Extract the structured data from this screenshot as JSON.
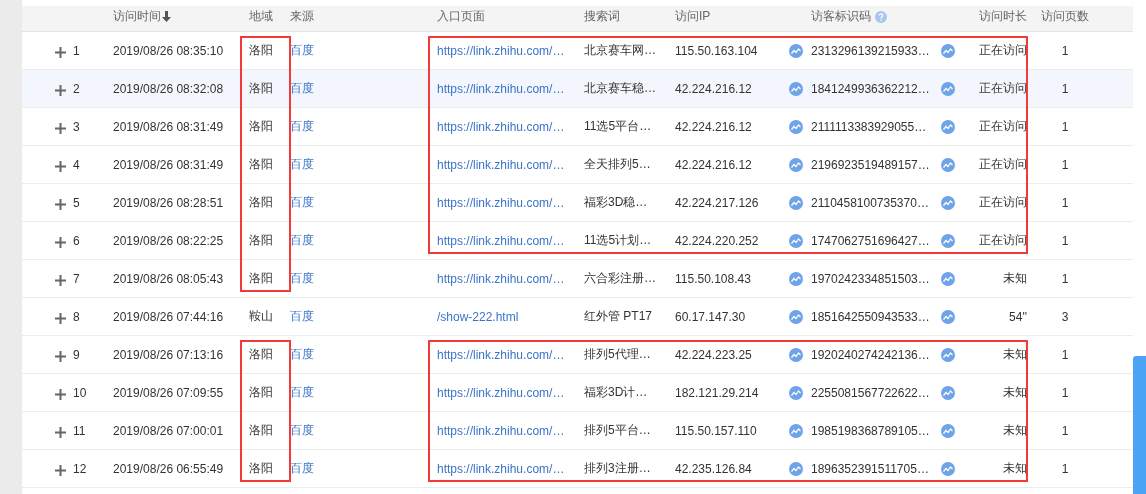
{
  "table": {
    "columns": [
      {
        "label": "访问时间",
        "sorted": true,
        "help": false
      },
      {
        "label": "地域",
        "sorted": false,
        "help": false
      },
      {
        "label": "来源",
        "sorted": false,
        "help": false
      },
      {
        "label": "入口页面",
        "sorted": false,
        "help": false
      },
      {
        "label": "搜索词",
        "sorted": false,
        "help": false
      },
      {
        "label": "访问IP",
        "sorted": false,
        "help": false
      },
      {
        "label": "访客标识码",
        "sorted": false,
        "help": true
      },
      {
        "label": "访问时长",
        "sorted": false,
        "help": false
      },
      {
        "label": "访问页数",
        "sorted": false,
        "help": false
      }
    ],
    "rows": [
      {
        "index": "1",
        "cells": [
          "2019/08/26 08:35:10",
          "洛阳",
          "百度",
          "https://link.zhihu.com/…",
          "北京赛车网…",
          "115.50.163.104",
          "2313296139215933…",
          "正在访问",
          "1"
        ],
        "selected": false,
        "region_framed": true,
        "details_framed": true
      },
      {
        "index": "2",
        "cells": [
          "2019/08/26 08:32:08",
          "洛阳",
          "百度",
          "https://link.zhihu.com/…",
          "北京赛车稳…",
          "42.224.216.12",
          "1841249936362212…",
          "正在访问",
          "1"
        ],
        "selected": true,
        "region_framed": true,
        "details_framed": true
      },
      {
        "index": "3",
        "cells": [
          "2019/08/26 08:31:49",
          "洛阳",
          "百度",
          "https://link.zhihu.com/…",
          "11选5平台…",
          "42.224.216.12",
          "2111113383929055…",
          "正在访问",
          "1"
        ],
        "selected": false,
        "region_framed": true,
        "details_framed": true
      },
      {
        "index": "4",
        "cells": [
          "2019/08/26 08:31:49",
          "洛阳",
          "百度",
          "https://link.zhihu.com/…",
          "全天排列5…",
          "42.224.216.12",
          "2196923519489157…",
          "正在访问",
          "1"
        ],
        "selected": false,
        "region_framed": true,
        "details_framed": true
      },
      {
        "index": "5",
        "cells": [
          "2019/08/26 08:28:51",
          "洛阳",
          "百度",
          "https://link.zhihu.com/…",
          "福彩3D稳…",
          "42.224.217.126",
          "2110458100735370…",
          "正在访问",
          "1"
        ],
        "selected": false,
        "region_framed": true,
        "details_framed": true
      },
      {
        "index": "6",
        "cells": [
          "2019/08/26 08:22:25",
          "洛阳",
          "百度",
          "https://link.zhihu.com/…",
          "11选5计划…",
          "42.224.220.252",
          "1747062751696427…",
          "正在访问",
          "1"
        ],
        "selected": false,
        "region_framed": true,
        "details_framed": true
      },
      {
        "index": "7",
        "cells": [
          "2019/08/26 08:05:43",
          "洛阳",
          "百度",
          "https://link.zhihu.com/…",
          "六合彩注册…",
          "115.50.108.43",
          "1970242334851503…",
          "未知",
          "1"
        ],
        "selected": false,
        "region_framed": true,
        "details_framed": false
      },
      {
        "index": "8",
        "cells": [
          "2019/08/26 07:44:16",
          "鞍山",
          "百度",
          "/show-222.html",
          "红外管 PT17",
          "60.17.147.30",
          "1851642550943533…",
          "54''",
          "3"
        ],
        "selected": false,
        "region_framed": false,
        "details_framed": false
      },
      {
        "index": "9",
        "cells": [
          "2019/08/26 07:13:16",
          "洛阳",
          "百度",
          "https://link.zhihu.com/…",
          "排列5代理…",
          "42.224.223.25",
          "1920240274242136…",
          "未知",
          "1"
        ],
        "selected": false,
        "region_framed": true,
        "details_framed": true
      },
      {
        "index": "10",
        "cells": [
          "2019/08/26 07:09:55",
          "洛阳",
          "百度",
          "https://link.zhihu.com/…",
          "福彩3D计…",
          "182.121.29.214",
          "2255081567722622…",
          "未知",
          "1"
        ],
        "selected": false,
        "region_framed": true,
        "details_framed": true
      },
      {
        "index": "11",
        "cells": [
          "2019/08/26 07:00:01",
          "洛阳",
          "百度",
          "https://link.zhihu.com/…",
          "排列5平台…",
          "115.50.157.110",
          "1985198368789105…",
          "未知",
          "1"
        ],
        "selected": false,
        "region_framed": true,
        "details_framed": true
      },
      {
        "index": "12",
        "cells": [
          "2019/08/26 06:55:49",
          "洛阳",
          "百度",
          "https://link.zhihu.com/…",
          "排列3注册…",
          "42.235.126.84",
          "1896352391511705…",
          "未知",
          "1"
        ],
        "selected": false,
        "region_framed": true,
        "details_framed": true
      }
    ]
  }
}
